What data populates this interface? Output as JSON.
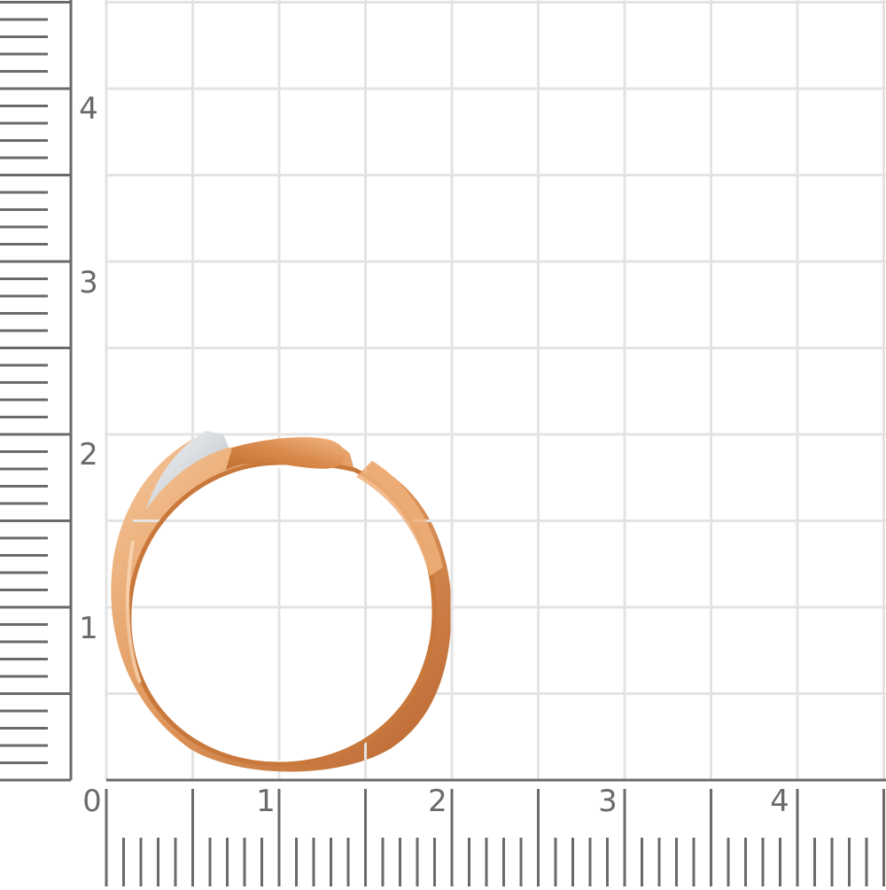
{
  "scale": {
    "x_labels": [
      "0",
      "1",
      "2",
      "3",
      "4"
    ],
    "y_labels": [
      "1",
      "2",
      "3",
      "4"
    ],
    "unit_note": ""
  },
  "colors": {
    "grid": "#e3e3e3",
    "ruler": "#6a6a6a",
    "gold_dark": "#c6743a",
    "gold_mid": "#e19a5f",
    "gold_light": "#f7c99d",
    "silver": "#d9dde2"
  },
  "object": {
    "name_icon": "gold-ring-icon"
  }
}
